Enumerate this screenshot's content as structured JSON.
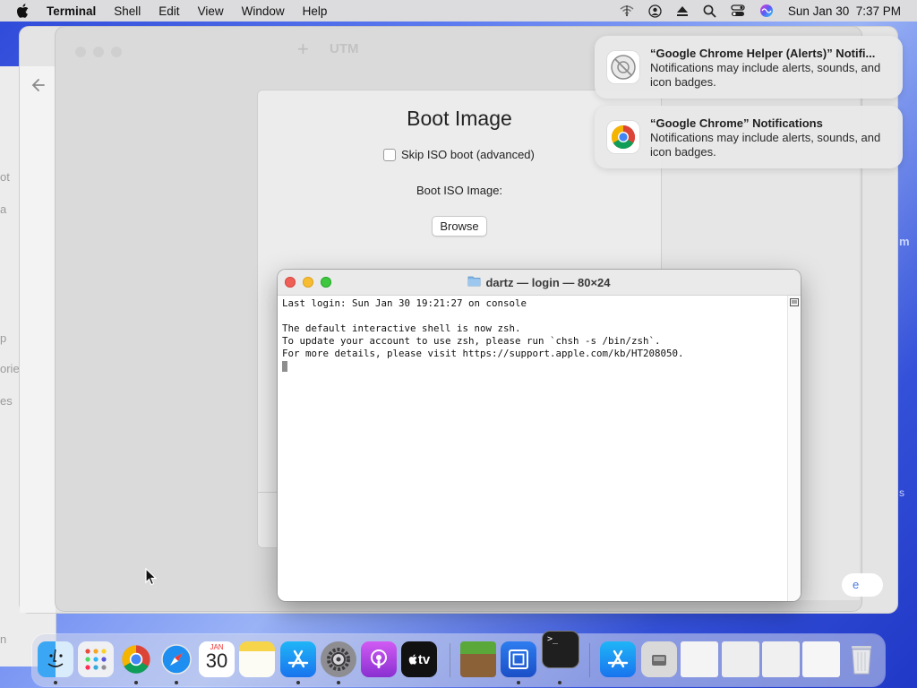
{
  "menubar": {
    "app_name": "Terminal",
    "items": [
      "Shell",
      "Edit",
      "View",
      "Window",
      "Help"
    ],
    "datetime": "Sun Jan 30  7:37 PM"
  },
  "utm_window": {
    "title": "UTM"
  },
  "boot_sheet": {
    "title": "Boot Image",
    "skip_label": "Skip ISO boot (advanced)",
    "iso_label": "Boot ISO Image:",
    "browse_label": "Browse"
  },
  "terminal": {
    "title": "dartz — login — 80×24",
    "lines": [
      "Last login: Sun Jan 30 19:21:27 on console",
      "",
      "The default interactive shell is now zsh.",
      "To update your account to use zsh, please run `chsh -s /bin/zsh`.",
      "For more details, please visit https://support.apple.com/kb/HT208050."
    ]
  },
  "notifications": [
    {
      "title": "“Google Chrome Helper (Alerts)” Notifi...",
      "body": "Notifications may include alerts, sounds, and icon badges."
    },
    {
      "title": "“Google Chrome” Notifications",
      "body": "Notifications may include alerts, sounds, and icon badges."
    }
  ],
  "dock": {
    "calendar_month": "JAN",
    "calendar_day": "30",
    "tv_label": "tv"
  },
  "background": {
    "sidebar_fragments": [
      "ot",
      "a",
      "p",
      "orie",
      "es",
      "n"
    ],
    "right_fragments": [
      "m",
      "s",
      "e"
    ]
  }
}
